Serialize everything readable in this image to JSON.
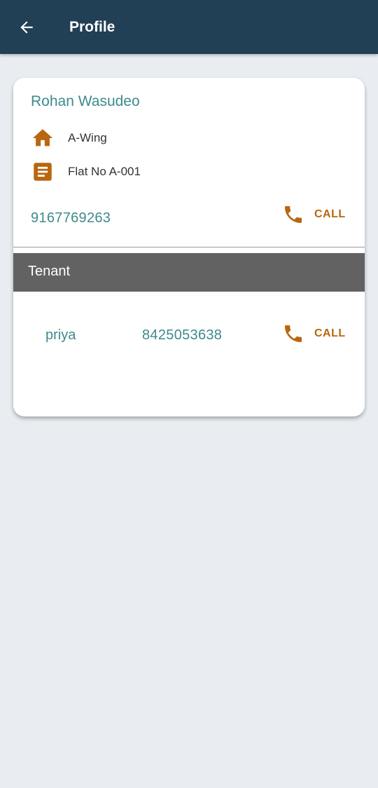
{
  "appbar": {
    "title": "Profile",
    "back_icon": "arrow-left-icon",
    "background": "#213f55"
  },
  "owner": {
    "name": "Rohan Wasudeo",
    "wing": "A-Wing",
    "wing_icon": "home-icon",
    "flat": "Flat No A-001",
    "flat_icon": "document-icon",
    "phone": "9167769263",
    "call_label": "CALL",
    "call_icon": "phone-icon"
  },
  "tenant_section": {
    "title": "Tenant",
    "tenants": [
      {
        "name": "priya",
        "phone": "8425053638",
        "call_label": "CALL",
        "call_icon": "phone-icon"
      }
    ]
  },
  "colors": {
    "accent_orange": "#b8670f",
    "teal_text": "#3e8a8c",
    "section_header": "#626262",
    "page_background": "#e9edf1"
  }
}
